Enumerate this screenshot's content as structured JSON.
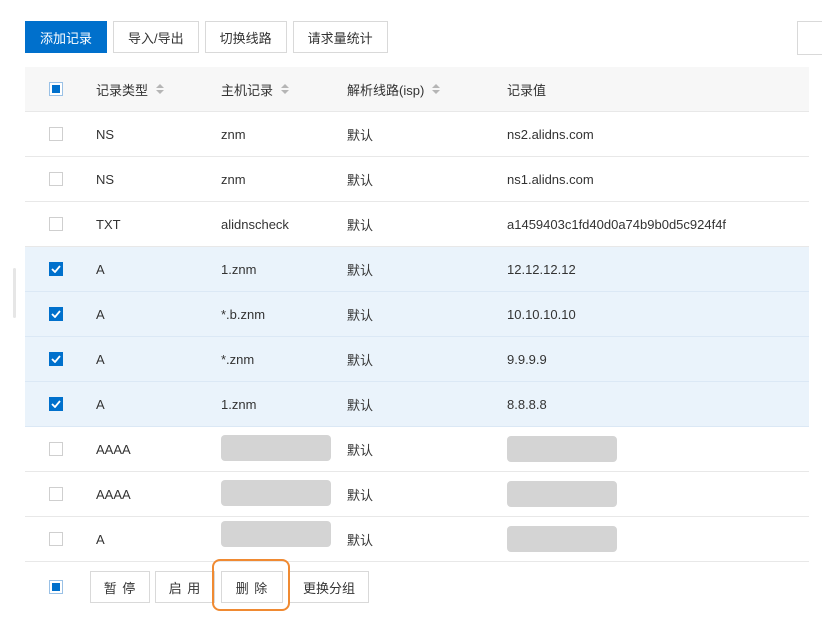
{
  "toolbar": {
    "add_record": "添加记录",
    "import_export": "导入/导出",
    "switch_line": "切换线路",
    "request_stats": "请求量统计"
  },
  "table": {
    "headers": {
      "type": "记录类型",
      "host": "主机记录",
      "line": "解析线路(isp)",
      "value": "记录值"
    },
    "rows": [
      {
        "type": "NS",
        "host": "znm",
        "line": "默认",
        "value": "ns2.alidns.com",
        "checked": false
      },
      {
        "type": "NS",
        "host": "znm",
        "line": "默认",
        "value": "ns1.alidns.com",
        "checked": false
      },
      {
        "type": "TXT",
        "host": "alidnscheck",
        "line": "默认",
        "value": "a1459403c1fd40d0a74b9b0d5c924f4f",
        "checked": false
      },
      {
        "type": "A",
        "host": "1.znm",
        "line": "默认",
        "value": "12.12.12.12",
        "checked": true
      },
      {
        "type": "A",
        "host": "*.b.znm",
        "line": "默认",
        "value": "10.10.10.10",
        "checked": true
      },
      {
        "type": "A",
        "host": "*.znm",
        "line": "默认",
        "value": "9.9.9.9",
        "checked": true
      },
      {
        "type": "A",
        "host": "1.znm",
        "line": "默认",
        "value": "8.8.8.8",
        "checked": true
      },
      {
        "type": "AAAA",
        "host": "",
        "line": "默认",
        "value": "",
        "checked": false
      },
      {
        "type": "AAAA",
        "host": "",
        "line": "默认",
        "value": "",
        "checked": false
      },
      {
        "type": "A",
        "host": "",
        "line": "默认",
        "value": "",
        "checked": false
      }
    ]
  },
  "footer": {
    "pause": "暂 停",
    "enable": "启 用",
    "delete": "删 除",
    "change_group": "更换分组"
  },
  "colors": {
    "primary": "#0070cc",
    "selected_row": "#eaf3fb",
    "highlight": "#f08a32"
  }
}
